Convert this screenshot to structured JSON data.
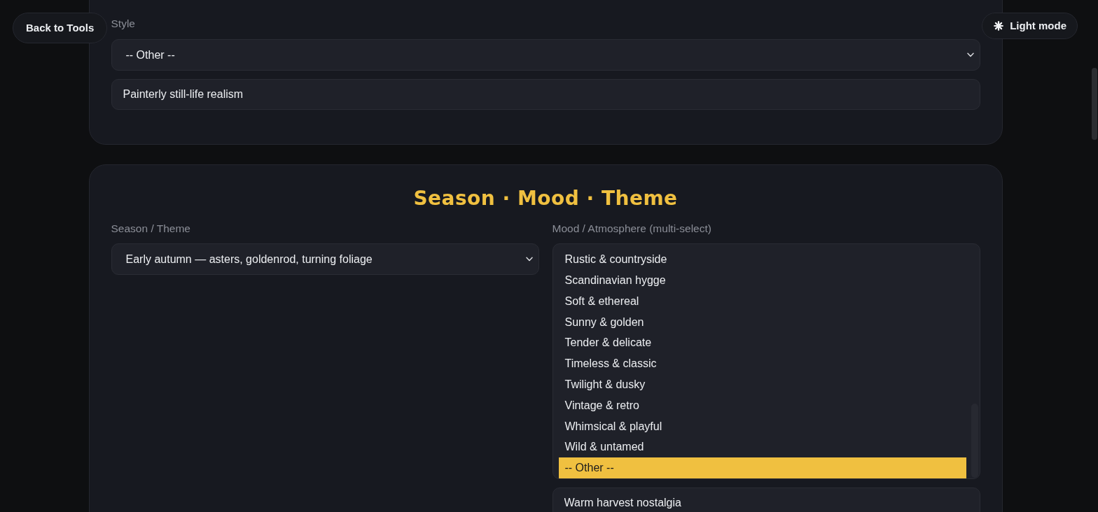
{
  "top_buttons": {
    "back": {
      "label": "Back to Tools"
    },
    "theme_toggle": {
      "label": "Light mode"
    }
  },
  "style_section": {
    "label": "Style",
    "select": {
      "value": "-- Other --"
    },
    "custom_input": {
      "value": "Painterly still-life realism"
    }
  },
  "season_section": {
    "title": "Season · Mood · Theme",
    "season": {
      "label": "Season / Theme",
      "select": {
        "value": "Early autumn — asters, goldenrod, turning foliage"
      }
    },
    "mood": {
      "label": "Mood / Atmosphere (multi-select)",
      "options": [
        {
          "label": "Rustic & countryside",
          "selected": false
        },
        {
          "label": "Scandinavian hygge",
          "selected": false
        },
        {
          "label": "Soft & ethereal",
          "selected": false
        },
        {
          "label": "Sunny & golden",
          "selected": false
        },
        {
          "label": "Tender & delicate",
          "selected": false
        },
        {
          "label": "Timeless & classic",
          "selected": false
        },
        {
          "label": "Twilight & dusky",
          "selected": false
        },
        {
          "label": "Vintage & retro",
          "selected": false
        },
        {
          "label": "Whimsical & playful",
          "selected": false
        },
        {
          "label": "Wild & untamed",
          "selected": false
        },
        {
          "label": "-- Other --",
          "selected": true
        }
      ],
      "custom_input": {
        "value": "Warm harvest nostalgia"
      }
    }
  }
}
